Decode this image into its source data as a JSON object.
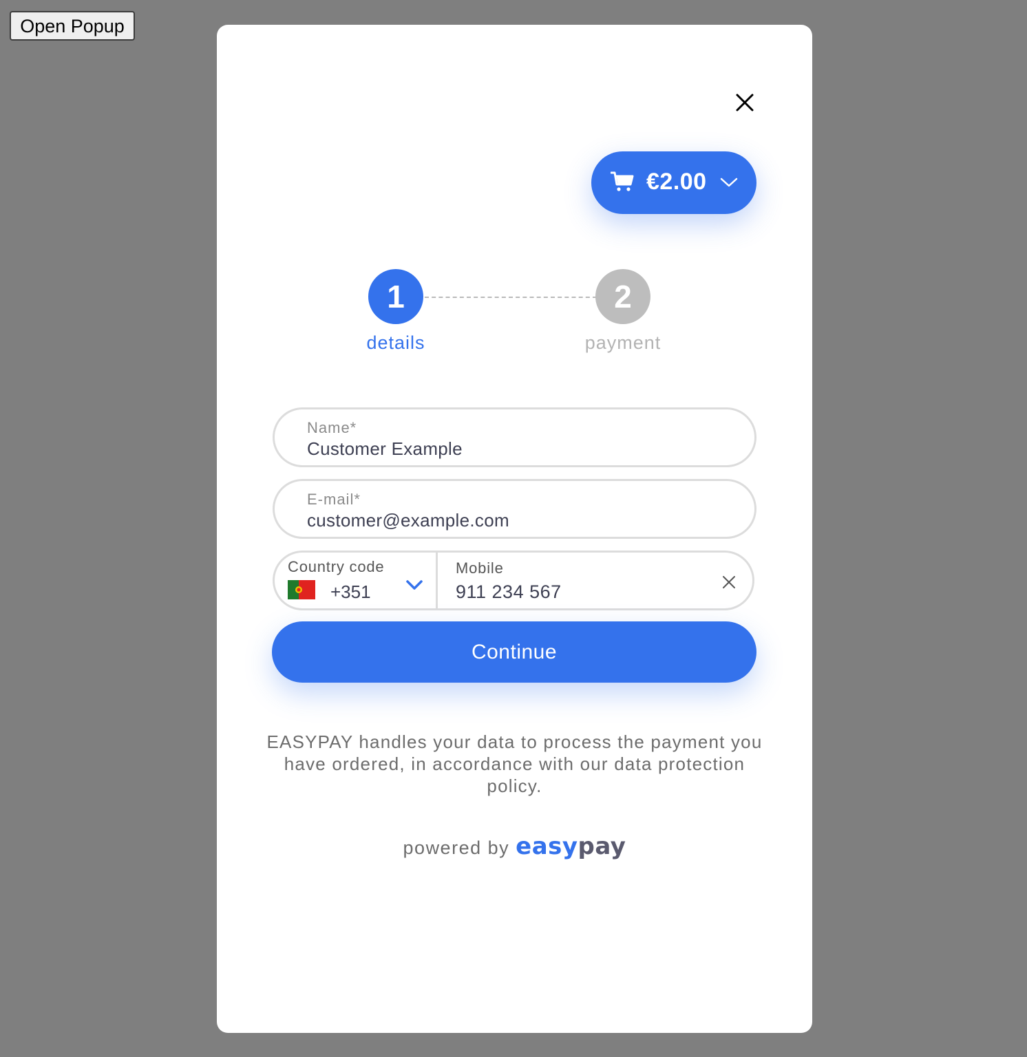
{
  "page": {
    "open_popup_label": "Open Popup"
  },
  "modal": {
    "cart": {
      "amount": "€2.00",
      "icon": "cart-icon",
      "accent": "#3472ec"
    },
    "steps": [
      {
        "number": "1",
        "label": "details",
        "state": "active"
      },
      {
        "number": "2",
        "label": "payment",
        "state": "inactive"
      }
    ],
    "form": {
      "name": {
        "label": "Name*",
        "value": "Customer Example"
      },
      "email": {
        "label": "E-mail*",
        "value": "customer@example.com"
      },
      "country_code": {
        "label": "Country code",
        "value": "+351",
        "flag": "portugal-flag"
      },
      "mobile": {
        "label": "Mobile",
        "value": "911 234 567"
      }
    },
    "continue_label": "Continue",
    "notice": "EASYPAY handles your data to process the payment you have ordered, in accordance with our data protection policy.",
    "powered_by": "powered by",
    "logo": {
      "part1": "easy",
      "part2": "pay"
    }
  }
}
